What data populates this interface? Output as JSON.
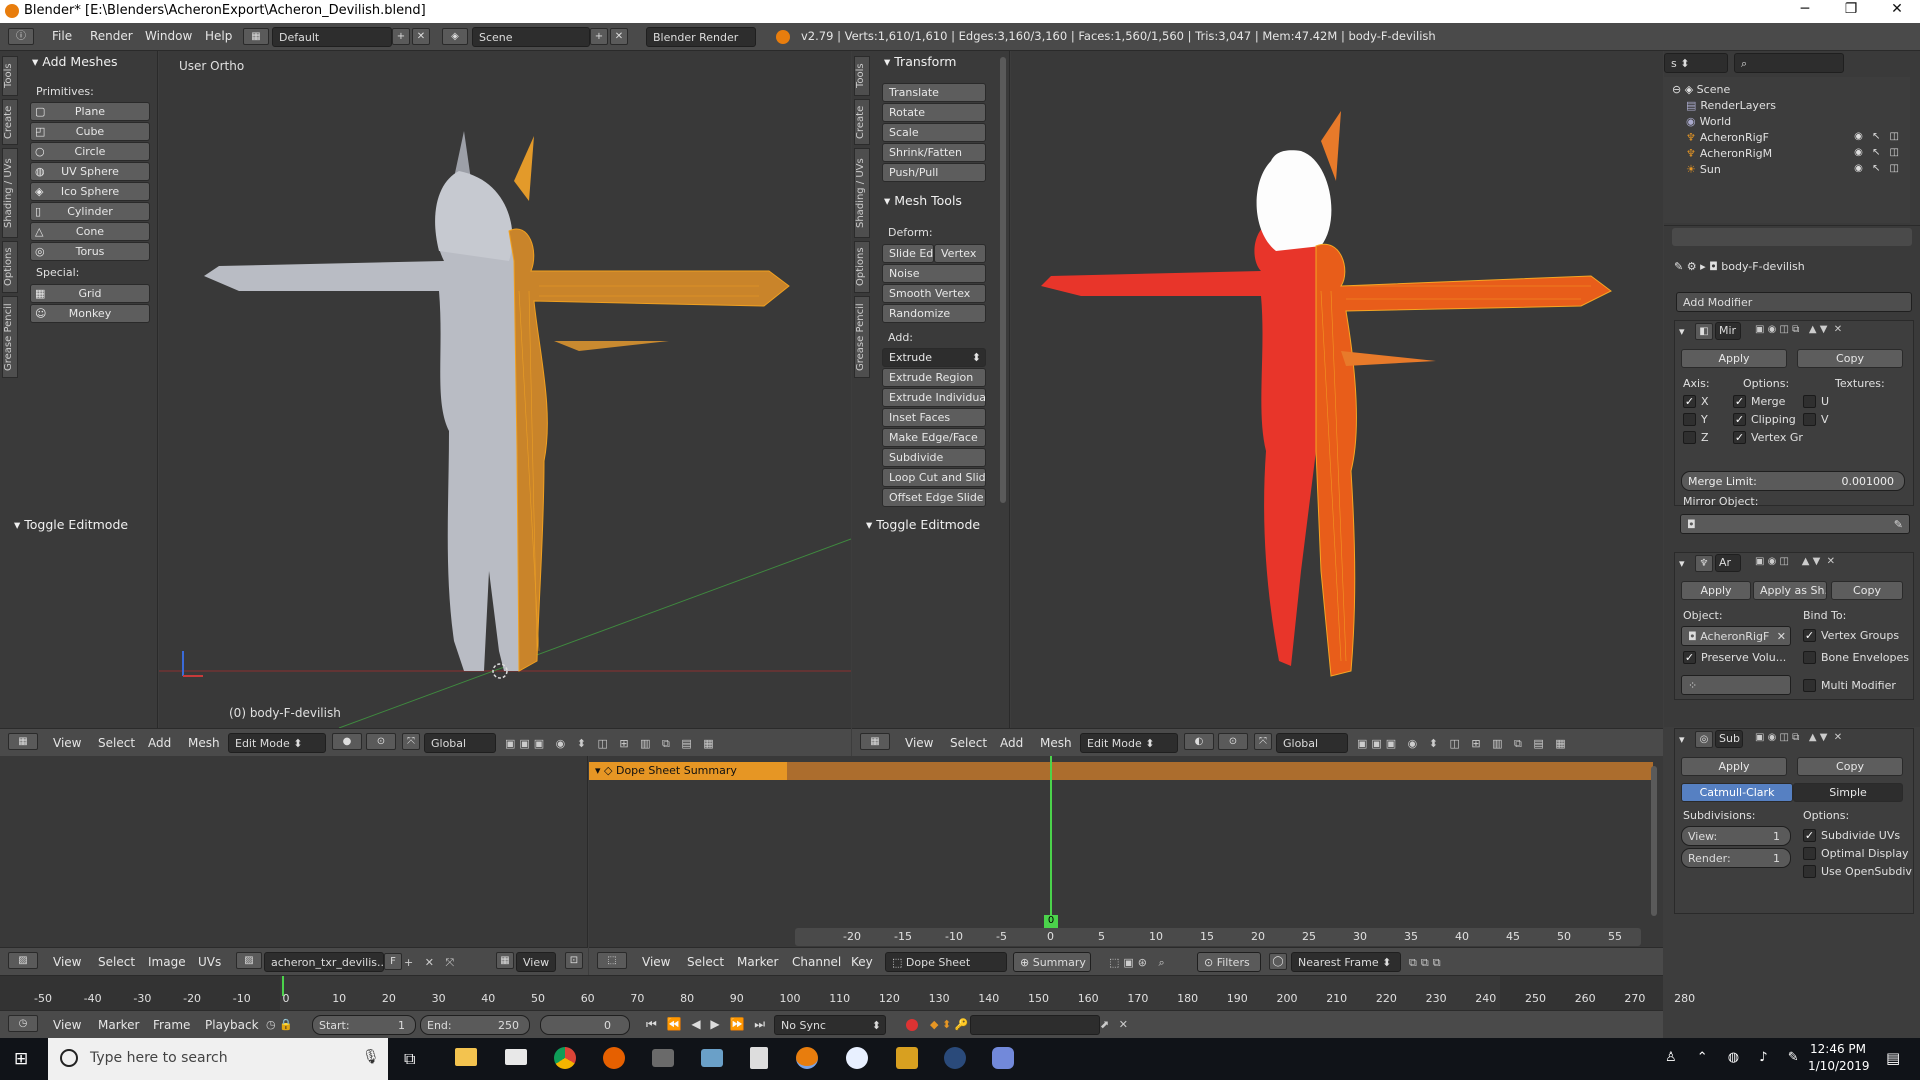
{
  "window": {
    "title": "Blender* [E:\\Blenders\\AcheronExport\\Acheron_Devilish.blend]",
    "min": "─",
    "max": "❐",
    "close": "✕"
  },
  "info": {
    "menus": [
      "File",
      "Render",
      "Window",
      "Help"
    ],
    "layout": "Default",
    "scene": "Scene",
    "engine": "Blender Render",
    "stats": "v2.79 | Verts:1,610/1,610 | Edges:3,160/3,160 | Faces:1,560/1,560 | Tris:3,047 | Mem:47.42M | body-F-devilish"
  },
  "toolshelf_left": {
    "tabs": [
      "Tools",
      "Create",
      "Shading / UVs",
      "Options",
      "Grease Pencil"
    ],
    "section": "Add Meshes",
    "primitives_label": "Primitives:",
    "primitives": [
      "Plane",
      "Cube",
      "Circle",
      "UV Sphere",
      "Ico Sphere",
      "Cylinder",
      "Cone",
      "Torus"
    ],
    "special_label": "Special:",
    "special": [
      "Grid",
      "Monkey"
    ],
    "operator": "Toggle Editmode"
  },
  "viewport_left": {
    "view_name": "User Ortho",
    "object_label": "(0) body-F-devilish",
    "menus": [
      "View",
      "Select",
      "Add",
      "Mesh"
    ],
    "mode": "Edit Mode",
    "orientation": "Global"
  },
  "toolshelf_mid": {
    "tabs": [
      "Tools",
      "Create",
      "Shading / UVs",
      "Options",
      "Grease Pencil"
    ],
    "transform_title": "Transform",
    "transform": [
      "Translate",
      "Rotate",
      "Scale",
      "Shrink/Fatten",
      "Push/Pull"
    ],
    "mesh_tools_title": "Mesh Tools",
    "deform_label": "Deform:",
    "slide_edge": "Slide Ed",
    "vertex": "Vertex",
    "deform": [
      "Noise",
      "Smooth Vertex",
      "Randomize"
    ],
    "add_label": "Add:",
    "extrude": "Extrude",
    "add": [
      "Extrude Region",
      "Extrude Individual",
      "Inset Faces",
      "Make Edge/Face",
      "Subdivide",
      "Loop Cut and Slide",
      "Offset Edge Slide"
    ],
    "operator": "Toggle Editmode"
  },
  "viewport_right": {
    "menus": [
      "View",
      "Select",
      "Add",
      "Mesh"
    ],
    "mode": "Edit Mode",
    "orientation": "Global"
  },
  "outliner": {
    "scene": "Scene",
    "items": [
      "RenderLayers",
      "World",
      "AcheronRigF",
      "AcheronRigM",
      "Sun"
    ]
  },
  "properties": {
    "object": "body-F-devilish",
    "add_modifier": "Add Modifier",
    "mirror": {
      "name": "Mir",
      "apply": "Apply",
      "copy": "Copy",
      "axis_label": "Axis:",
      "options_label": "Options:",
      "textures_label": "Textures:",
      "axes": [
        "X",
        "Y",
        "Z"
      ],
      "axes_checked": [
        true,
        false,
        false
      ],
      "options": [
        "Merge",
        "Clipping",
        "Vertex Gr"
      ],
      "textures": [
        "U",
        "V"
      ],
      "merge_limit_label": "Merge Limit:",
      "merge_limit": "0.001000",
      "mirror_object_label": "Mirror Object:"
    },
    "armature": {
      "name": "Ar",
      "apply": "Apply",
      "apply_shape": "Apply as Sh...",
      "copy": "Copy",
      "object_label": "Object:",
      "object": "AcheronRigF",
      "bind_label": "Bind To:",
      "vertex_groups": "Vertex Groups",
      "preserve": "Preserve Volu...",
      "bone_env": "Bone Envelopes",
      "multi": "Multi Modifier"
    },
    "subsurf": {
      "name": "Sub",
      "apply": "Apply",
      "copy": "Copy",
      "catmull": "Catmull-Clark",
      "simple": "Simple",
      "subdiv_label": "Subdivisions:",
      "options_label": "Options:",
      "view_label": "View:",
      "view": "1",
      "render_label": "Render:",
      "render": "1",
      "opts": [
        "Subdivide UVs",
        "Optimal Display",
        "Use OpenSubdiv"
      ],
      "opts_checked": [
        true,
        false,
        false
      ]
    }
  },
  "uv_editor": {
    "menus": [
      "View",
      "Select",
      "Image",
      "UVs"
    ],
    "image": "acheron_txr_devilis...",
    "f": "F",
    "view": "View"
  },
  "dopesheet": {
    "summary_label": "Dope Sheet Summary",
    "ticks": [
      "-20",
      "-15",
      "-10",
      "-5",
      "0",
      "5",
      "10",
      "15",
      "20",
      "25",
      "30",
      "35",
      "40",
      "45",
      "50",
      "55"
    ],
    "current_frame": "0",
    "menus": [
      "View",
      "Select",
      "Marker",
      "Channel",
      "Key"
    ],
    "mode": "Dope Sheet",
    "summary": "Summary",
    "filters": "Filters",
    "nearest": "Nearest Frame"
  },
  "timeline": {
    "ticks": [
      "-50",
      "-40",
      "-30",
      "-20",
      "-10",
      "0",
      "10",
      "20",
      "30",
      "40",
      "50",
      "60",
      "70",
      "80",
      "90",
      "100",
      "110",
      "120",
      "130",
      "140",
      "150",
      "160",
      "170",
      "180",
      "190",
      "200",
      "210",
      "220",
      "230",
      "240",
      "250",
      "260",
      "270",
      "280"
    ],
    "menus": [
      "View",
      "Marker",
      "Frame",
      "Playback"
    ],
    "start_label": "Start:",
    "start": "1",
    "end_label": "End:",
    "end": "250",
    "current": "0",
    "sync": "No Sync"
  },
  "taskbar": {
    "search": "Type here to search",
    "time": "12:46 PM",
    "date": "1/10/2019"
  },
  "colors": {
    "accent": "#e69624",
    "header": "#4a4a4a",
    "viewport": "#393939",
    "panel": "#3a3a3a"
  }
}
